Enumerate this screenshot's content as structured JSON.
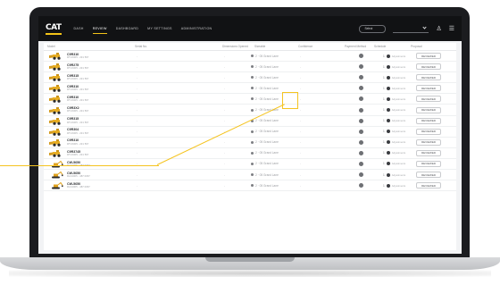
{
  "app": {
    "logo": "CAT",
    "nav": [
      {
        "label": "Dash",
        "active": false
      },
      {
        "label": "Review",
        "active": true
      },
      {
        "label": "Dashboard",
        "active": false
      },
      {
        "label": "My Settings",
        "active": false
      },
      {
        "label": "Administration",
        "active": false
      }
    ],
    "top_select": "Select",
    "colors": {
      "accent": "#f5c421",
      "topbar": "#111214"
    }
  },
  "table": {
    "headers": [
      "Model",
      "Serial No.",
      "Dimensions Opened",
      "Sizeable",
      "Confidence",
      "Payment Method",
      "Schedule",
      "Proposal"
    ],
    "rows": [
      {
        "model": "C9R310",
        "sub": "RTV2005 - 231 567",
        "spec": "2 · 05 Grand Lane",
        "progress": "Adjustments",
        "action": "REVIEWED",
        "machine": "wheel-loader"
      },
      {
        "model": "C9R275",
        "sub": "RTV2005 - 231 567",
        "spec": "2 · 05 Grand Lane",
        "progress": "Adjustments",
        "action": "REVIEWED",
        "machine": "wheel-loader"
      },
      {
        "model": "C9R315",
        "sub": "RTV2005 - 231 567",
        "spec": "2 · 05 Grand Lane",
        "progress": "Adjustments",
        "action": "REVIEWED",
        "machine": "wheel-loader"
      },
      {
        "model": "C9R310",
        "sub": "RTV2005 - 231 567",
        "spec": "2 · 05 Grand Lane",
        "progress": "Adjustments",
        "action": "REVIEWED",
        "machine": "wheel-loader"
      },
      {
        "model": "C9R310",
        "sub": "RTV2005 - 231 567",
        "spec": "2 · 05 Grand Lane",
        "progress": "Adjustments",
        "action": "REVIEWED",
        "machine": "wheel-loader"
      },
      {
        "model": "C9R3X2",
        "sub": "RTV2005 - 231 567",
        "spec": "2 · 05 Grand Lane",
        "progress": "Adjustments",
        "action": "REVIEWED",
        "machine": "wheel-loader"
      },
      {
        "model": "C9R315",
        "sub": "RTV2005 - 231 567",
        "spec": "2 · 05 Grand Lane",
        "progress": "Adjustments",
        "action": "REVIEWED",
        "machine": "wheel-loader"
      },
      {
        "model": "C9R304",
        "sub": "RTV2005 - 231 567",
        "spec": "2 · 05 Grand Lane",
        "progress": "Adjustments",
        "action": "REVIEWED",
        "machine": "wheel-loader"
      },
      {
        "model": "C9R310",
        "sub": "RTV2005 - 231 567",
        "spec": "2 · 05 Grand Lane",
        "progress": "Adjustments",
        "action": "REVIEWED",
        "machine": "wheel-loader"
      },
      {
        "model": "C9R3745",
        "sub": "RTV2005 - 231 567",
        "spec": "2 · 05 Grand Lane",
        "progress": "Adjustments",
        "action": "REVIEWED",
        "machine": "wheel-loader"
      },
      {
        "model": "CW-5650",
        "sub": "RLK2005 - 487 0067",
        "spec": "2 · 05 Grand Lane",
        "progress": "Adjustments",
        "action": "REVIEWED",
        "machine": "excavator"
      },
      {
        "model": "CW-5650",
        "sub": "RLK2005 - 487 0067",
        "spec": "2 · 05 Grand Lane",
        "progress": "Adjustments",
        "action": "REVIEWED",
        "machine": "excavator"
      },
      {
        "model": "CW-5650",
        "sub": "RLK2005 - 487 0067",
        "spec": "2 · 05 Grand Lane",
        "progress": "Adjustments",
        "action": "REVIEWED",
        "machine": "excavator"
      }
    ]
  }
}
